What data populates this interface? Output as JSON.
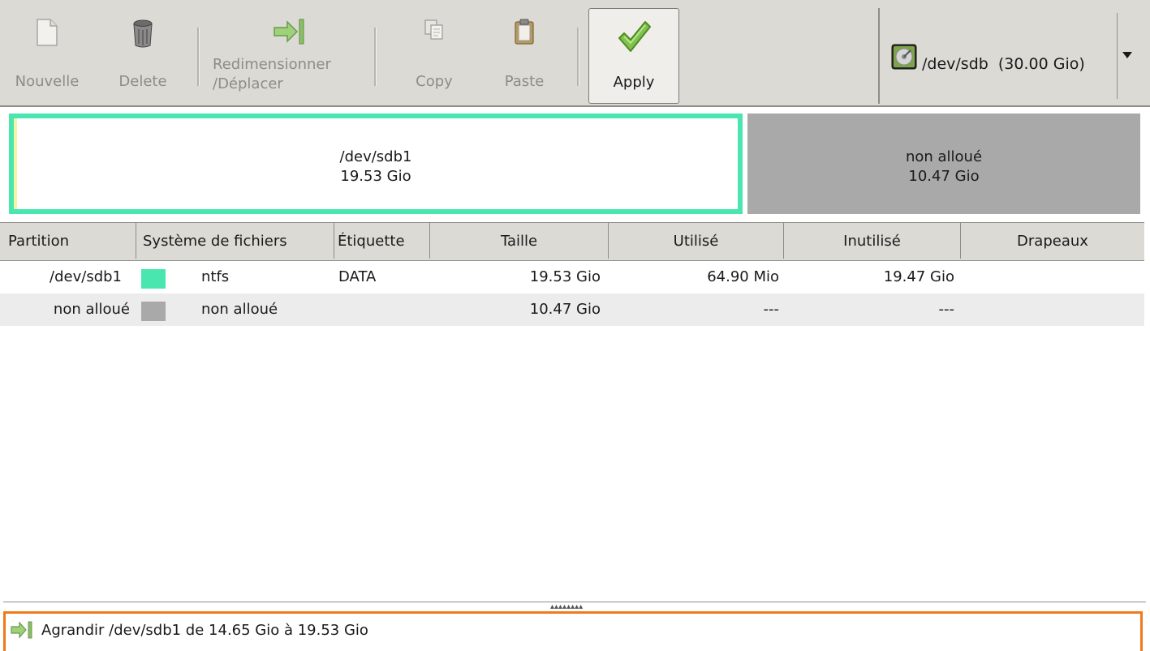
{
  "toolbar": {
    "new_label": "Nouvelle",
    "delete_label": "Delete",
    "resize_label": "Redimensionner\n/Déplacer",
    "copy_label": "Copy",
    "paste_label": "Paste",
    "apply_label": "Apply"
  },
  "device_selector": {
    "label": "/dev/sdb  (30.00 Gio)"
  },
  "partition_map": {
    "sdb1": {
      "name": "/dev/sdb1",
      "size": "19.53 Gio"
    },
    "unallocated": {
      "name": "non alloué",
      "size": "10.47 Gio"
    }
  },
  "table": {
    "headers": {
      "partition": "Partition",
      "filesystem": "Système de fichiers",
      "label": "Étiquette",
      "size": "Taille",
      "used": "Utilisé",
      "unused": "Inutilisé",
      "flags": "Drapeaux"
    },
    "rows": [
      {
        "partition": "/dev/sdb1",
        "fs_color": "#4ae6b0",
        "filesystem": "ntfs",
        "label": "DATA",
        "size": "19.53 Gio",
        "used": "64.90 Mio",
        "unused": "19.47 Gio",
        "flags": ""
      },
      {
        "partition": "non alloué",
        "fs_color": "#a9a9a9",
        "filesystem": "non alloué",
        "label": "",
        "size": "10.47 Gio",
        "used": "---",
        "unused": "---",
        "flags": ""
      }
    ]
  },
  "operations": [
    {
      "text": "Agrandir /dev/sdb1 de 14.65 Gio à 19.53 Gio",
      "icon": "resize-arrow-icon"
    }
  ],
  "colors": {
    "ntfs": "#4ae6b0",
    "unallocated": "#a9a9a9",
    "operations_border": "#f07a1a"
  }
}
